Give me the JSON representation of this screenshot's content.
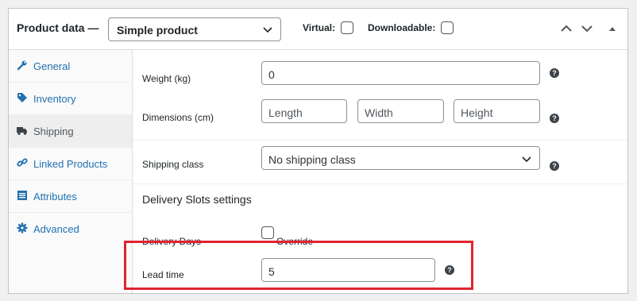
{
  "header": {
    "title": "Product data —",
    "product_type": "Simple product",
    "virtual_label": "Virtual:",
    "downloadable_label": "Downloadable:",
    "virtual_checked": false,
    "downloadable_checked": false
  },
  "sidebar": {
    "items": [
      {
        "label": "General",
        "icon": "wrench-icon",
        "active": false
      },
      {
        "label": "Inventory",
        "icon": "tag-icon",
        "active": false
      },
      {
        "label": "Shipping",
        "icon": "truck-icon",
        "active": true
      },
      {
        "label": "Linked Products",
        "icon": "link-icon",
        "active": false
      },
      {
        "label": "Attributes",
        "icon": "list-icon",
        "active": false
      },
      {
        "label": "Advanced",
        "icon": "gear-icon",
        "active": false
      }
    ]
  },
  "shipping": {
    "weight_label": "Weight (kg)",
    "weight_value": "0",
    "dimensions_label": "Dimensions (cm)",
    "length_placeholder": "Length",
    "width_placeholder": "Width",
    "height_placeholder": "Height",
    "shipping_class_label": "Shipping class",
    "shipping_class_value": "No shipping class"
  },
  "delivery": {
    "section_title": "Delivery Slots settings",
    "days_label": "Delivery Days",
    "override_label": "Override",
    "override_checked": false,
    "lead_time_label": "Lead time",
    "lead_time_value": "5"
  },
  "help_glyph": "?",
  "colors": {
    "link": "#2271b1",
    "highlight": "#e0242f"
  }
}
